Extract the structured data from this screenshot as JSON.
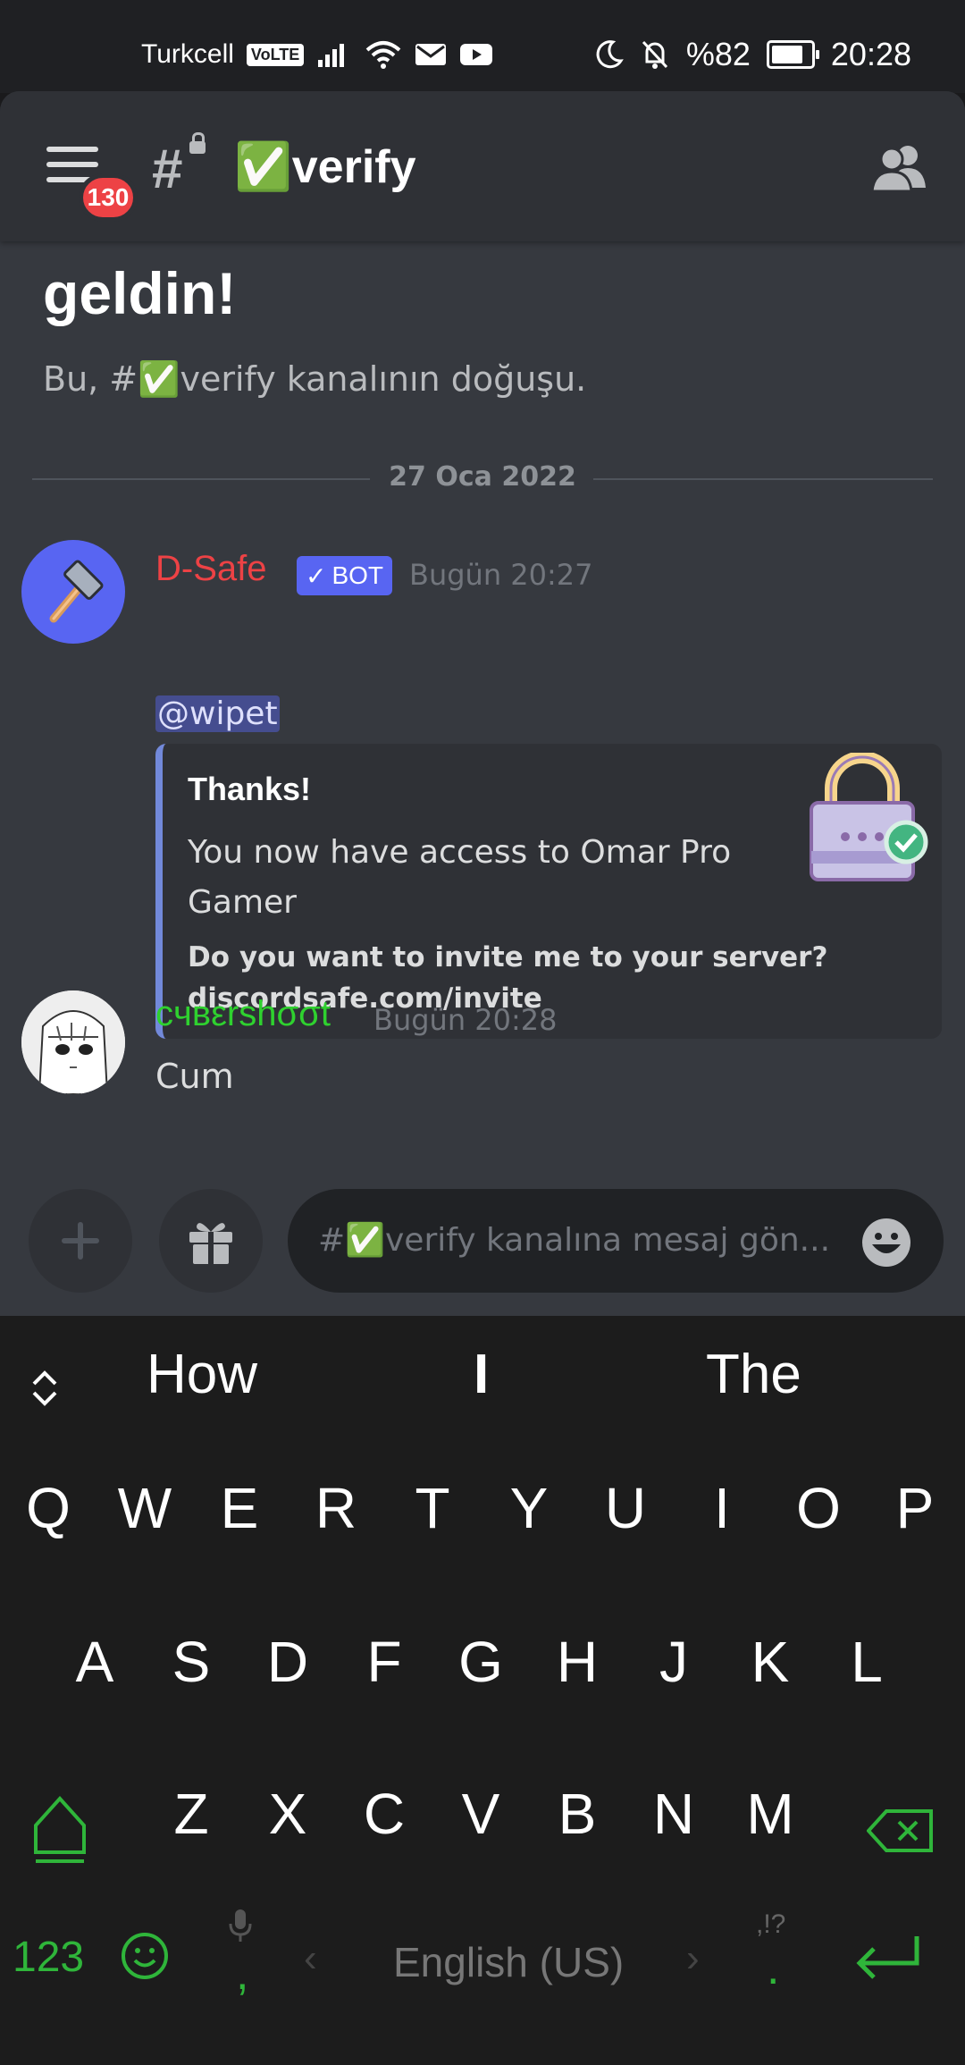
{
  "status_bar": {
    "carrier": "Turkcell",
    "volte": "VoLTE",
    "battery": "%82",
    "time": "20:28"
  },
  "header": {
    "badge_count": "130",
    "channel_name": "✅verify"
  },
  "welcome": {
    "title": "geldin!",
    "subtitle": "Bu, #✅verify kanalının doğuşu."
  },
  "date_divider": "27 Oca 2022",
  "messages": [
    {
      "author": "D-Safe",
      "author_color": "#ed4245",
      "bot_tag": "BOT",
      "time": "Bugün 20:27",
      "mention": "@wipet",
      "embed": {
        "title": "Thanks!",
        "description": "You now have access to Omar Pro Gamer",
        "field_line1": "Do you want to invite me to your server?",
        "field_line2": "discordsafe.com/invite",
        "thumbnail_icon": "padlock-check-icon"
      }
    },
    {
      "author": "cчвεrshσσt",
      "author_color": "#2fd12f",
      "time": "Bugün 20:28",
      "text": "Cum"
    }
  ],
  "composer": {
    "placeholder": "#✅verify kanalına mesaj gön..."
  },
  "keyboard": {
    "suggestions": [
      "How",
      "I",
      "The"
    ],
    "row1": [
      "Q",
      "W",
      "E",
      "R",
      "T",
      "Y",
      "U",
      "I",
      "O",
      "P"
    ],
    "row2": [
      "A",
      "S",
      "D",
      "F",
      "G",
      "H",
      "J",
      "K",
      "L"
    ],
    "row3": [
      "Z",
      "X",
      "C",
      "V",
      "B",
      "N",
      "M"
    ],
    "numbers_key": "123",
    "comma_key": ",",
    "space_label": "English (US)",
    "period_key": ".",
    "punct_hint": ",!?",
    "accent_color": "#2fb53a"
  }
}
